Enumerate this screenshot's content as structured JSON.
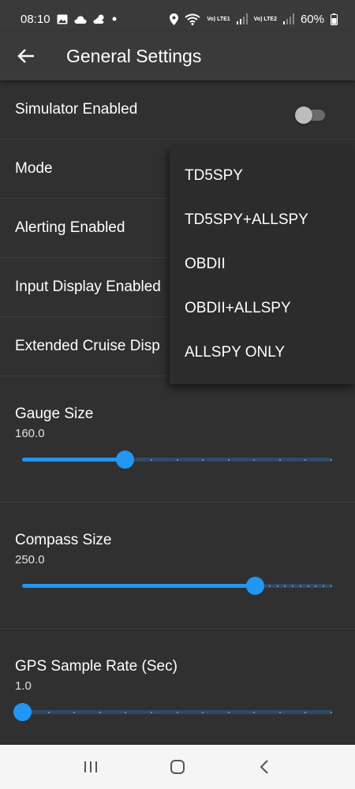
{
  "status_bar": {
    "time": "08:10",
    "battery": "60%",
    "lte1": "Vo) LTE1",
    "lte2": "Vo) LTE2",
    "icons": [
      "image-icon",
      "cloud-icon",
      "weather-icon",
      "dot-icon",
      "location-icon",
      "wifi-icon",
      "signal-icon",
      "battery-icon"
    ]
  },
  "app_bar": {
    "title": "General Settings",
    "back_icon": "arrow-left-icon"
  },
  "settings": {
    "simulator": {
      "label": "Simulator Enabled",
      "enabled": false
    },
    "mode": {
      "label": "Mode"
    },
    "alerting": {
      "label": "Alerting Enabled"
    },
    "input_display": {
      "label": "Input Display Enabled"
    },
    "extended_cruise": {
      "label": "Extended Cruise Disp"
    }
  },
  "sliders": {
    "gauge": {
      "label": "Gauge Size",
      "value": "160.0",
      "fraction": 0.33
    },
    "compass": {
      "label": "Compass Size",
      "value": "250.0",
      "fraction": 0.75
    },
    "gps": {
      "label": "GPS Sample Rate (Sec)",
      "value": "1.0",
      "fraction": 0.0
    }
  },
  "dropdown": {
    "options": [
      "TD5SPY",
      "TD5SPY+ALLSPY",
      "OBDII",
      "OBDII+ALLSPY",
      "ALLSPY ONLY"
    ]
  },
  "nav_bar": {
    "icons": [
      "recent-apps-icon",
      "home-icon",
      "back-icon"
    ]
  },
  "colors": {
    "accent": "#2196f3",
    "background": "#303030",
    "bar": "#3a3a3a"
  }
}
